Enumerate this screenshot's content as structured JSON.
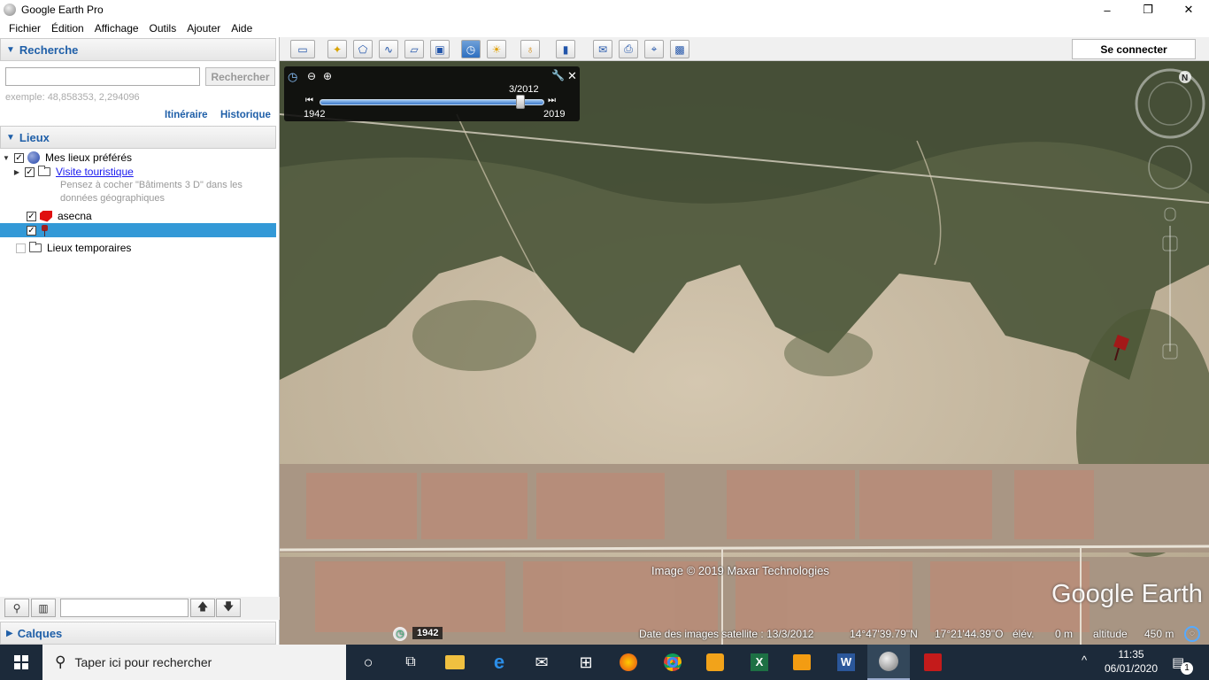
{
  "window": {
    "title": "Google Earth Pro",
    "minimize_glyph": "–",
    "maximize_glyph": "❐",
    "close_glyph": "✕"
  },
  "menu": [
    "Fichier",
    "Édition",
    "Affichage",
    "Outils",
    "Ajouter",
    "Aide"
  ],
  "search": {
    "header": "Recherche",
    "input_value": "",
    "button_label": "Rechercher",
    "example": "exemple: 48,858353, 2,294096",
    "itinerary_label": "Itinéraire",
    "history_label": "Historique"
  },
  "places": {
    "header": "Lieux",
    "items": [
      {
        "label": "Mes lieux préférés",
        "checked": true,
        "icon": "globe-icon"
      },
      {
        "label": "Visite touristique",
        "checked": true,
        "icon": "folder-icon",
        "link": true,
        "description": "Pensez à cocher \"Bâtiments 3 D\" dans les données géographiques"
      },
      {
        "label": "asecna",
        "checked": true,
        "icon": "polygon-icon"
      },
      {
        "label": "",
        "checked": true,
        "icon": "placemark-icon",
        "selected": true
      },
      {
        "label": "Lieux temporaires",
        "checked": false,
        "icon": "folder-icon"
      }
    ]
  },
  "layers": {
    "header": "Calques"
  },
  "toolbar": {
    "signin_label": "Se connecter"
  },
  "timeslider": {
    "current": "3/2012",
    "start": "1942",
    "end": "2019",
    "position_fraction": 0.91
  },
  "map": {
    "attribution": "Image © 2019 Maxar Technologies",
    "logo": "Google Earth",
    "historic_year": "1942",
    "status": {
      "imagery_date": "Date des images satellite : 13/3/2012",
      "lat": "14°47'39.79\"N",
      "lon": "17°21'44.39\"O",
      "elev_label": "élév.",
      "elev_value": "0 m",
      "alt_label": "altitude",
      "alt_value": "450 m"
    }
  },
  "taskbar": {
    "search_placeholder": "Taper ici pour rechercher",
    "time": "11:35",
    "date": "06/01/2020",
    "notification_count": "1"
  },
  "colors": {
    "accent": "#1f5fa8",
    "selection": "#3399d7",
    "taskbar": "#1c2a3a"
  }
}
